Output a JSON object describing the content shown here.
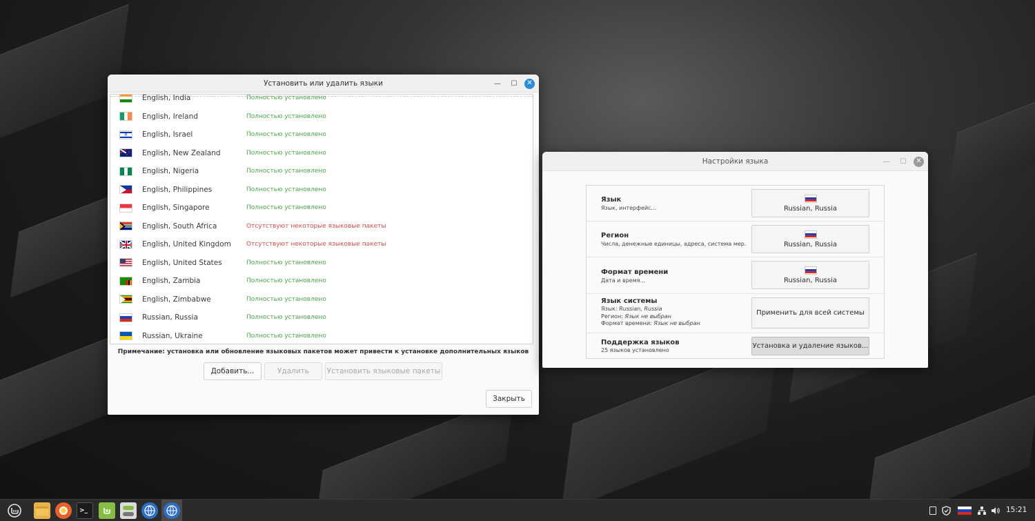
{
  "install_window": {
    "title": "Установить или удалить языки",
    "languages": [
      {
        "name": "English, India",
        "status": "Полностью установлено",
        "state": "ok",
        "flag": "india"
      },
      {
        "name": "English, Ireland",
        "status": "Полностью установлено",
        "state": "ok",
        "flag": "ireland"
      },
      {
        "name": "English, Israel",
        "status": "Полностью установлено",
        "state": "ok",
        "flag": "israel"
      },
      {
        "name": "English, New Zealand",
        "status": "Полностью установлено",
        "state": "ok",
        "flag": "new-zealand"
      },
      {
        "name": "English, Nigeria",
        "status": "Полностью установлено",
        "state": "ok",
        "flag": "nigeria"
      },
      {
        "name": "English, Philippines",
        "status": "Полностью установлено",
        "state": "ok",
        "flag": "philippines"
      },
      {
        "name": "English, Singapore",
        "status": "Полностью установлено",
        "state": "ok",
        "flag": "singapore"
      },
      {
        "name": "English, South Africa",
        "status": "Отсутствуют некоторые языковые пакеты",
        "state": "missing",
        "flag": "south-africa"
      },
      {
        "name": "English, United Kingdom",
        "status": "Отсутствуют некоторые языковые пакеты",
        "state": "missing",
        "flag": "united-kingdom"
      },
      {
        "name": "English, United States",
        "status": "Полностью установлено",
        "state": "ok",
        "flag": "united-states"
      },
      {
        "name": "English, Zambia",
        "status": "Полностью установлено",
        "state": "ok",
        "flag": "zambia"
      },
      {
        "name": "English, Zimbabwe",
        "status": "Полностью установлено",
        "state": "ok",
        "flag": "zimbabwe"
      },
      {
        "name": "Russian, Russia",
        "status": "Полностью установлено",
        "state": "ok",
        "flag": "russia"
      },
      {
        "name": "Russian, Ukraine",
        "status": "Полностью установлено",
        "state": "ok",
        "flag": "ukraine"
      }
    ],
    "note": "Примечание: установка или обновление языковых пакетов может привести к установке дополнительных языков",
    "add_label": "Добавить...",
    "remove_label": "Удалить",
    "install_packs_label": "Установить языковые пакеты",
    "close_label": "Закрыть"
  },
  "settings_window": {
    "title": "Настройки языка",
    "language": {
      "heading": "Язык",
      "sub": "Язык, интерфейс...",
      "value": "Russian, Russia"
    },
    "region": {
      "heading": "Регион",
      "sub": "Числа, денежные единицы, адреса, система мер...",
      "value": "Russian, Russia"
    },
    "time_format": {
      "heading": "Формат времени",
      "sub": "Дата и время...",
      "value": "Russian, Russia"
    },
    "system_language": {
      "heading": "Язык системы",
      "lang_label": "Язык:",
      "lang_value": "Russian, Russia",
      "region_label": "Регион:",
      "region_value": "Язык не выбран",
      "time_label": "Формат времени:",
      "time_value": "Язык не выбран",
      "apply_label": "Применить для всей системы"
    },
    "support": {
      "heading": "Поддержка языков",
      "sub": "25 языков установлено",
      "button_label": "Установка и удаление языков..."
    }
  },
  "taskbar": {
    "clock": "15:21",
    "apps": [
      "mint-menu-icon",
      "files-icon",
      "firefox-icon",
      "terminal-icon",
      "mintinstall-icon",
      "settings-icon",
      "language-icon",
      "language-icon-active"
    ]
  },
  "colors": {
    "accent": "#2e8bd6",
    "ok": "#4aa64a",
    "missing": "#d84a4a",
    "mint": "#86be43"
  }
}
